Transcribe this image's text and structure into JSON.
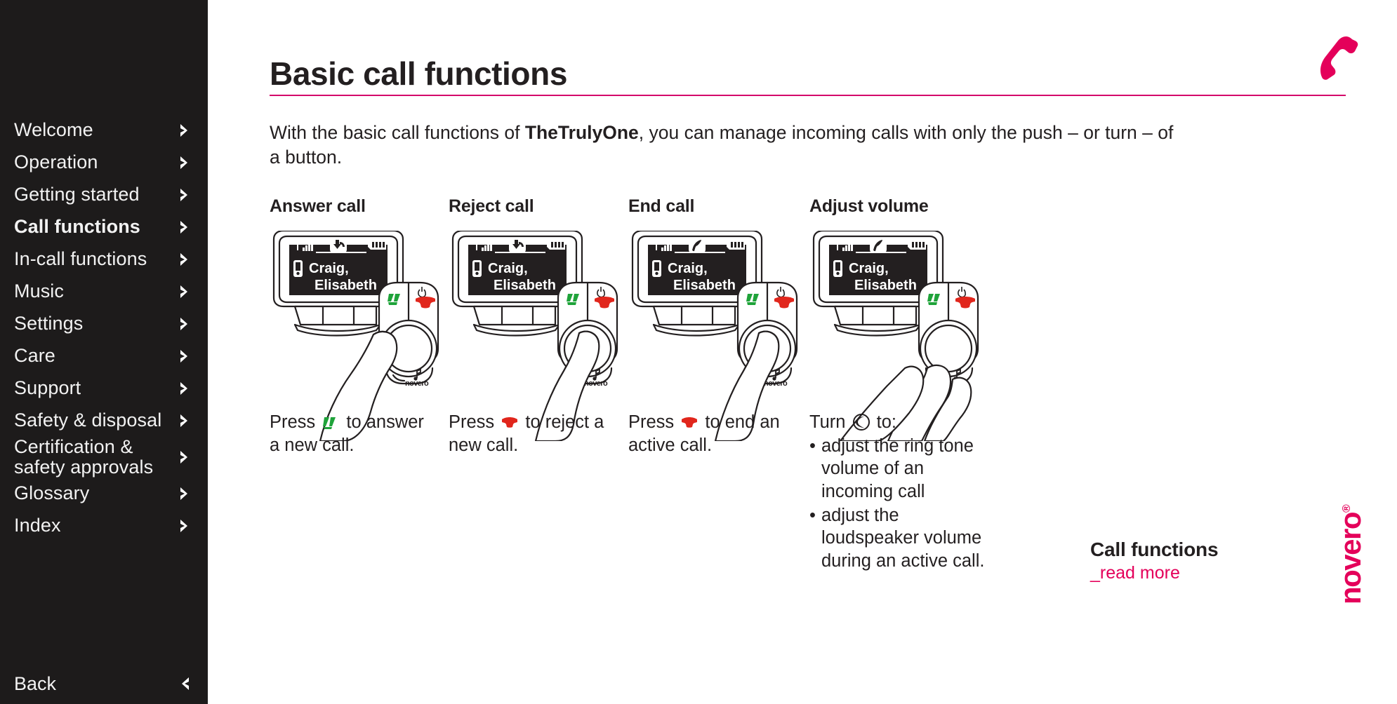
{
  "sidebar": {
    "items": [
      {
        "label": "Welcome",
        "active": false,
        "icon": "chevron-right-icon"
      },
      {
        "label": "Operation",
        "active": false,
        "icon": "chevron-right-icon"
      },
      {
        "label": "Getting started",
        "active": false,
        "icon": "chevron-right-icon"
      },
      {
        "label": "Call functions",
        "active": true,
        "icon": "chevron-right-icon"
      },
      {
        "label": "In-call functions",
        "active": false,
        "icon": "chevron-right-icon"
      },
      {
        "label": "Music",
        "active": false,
        "icon": "chevron-right-icon"
      },
      {
        "label": "Settings",
        "active": false,
        "icon": "chevron-right-icon"
      },
      {
        "label": "Care",
        "active": false,
        "icon": "chevron-right-icon"
      },
      {
        "label": "Support",
        "active": false,
        "icon": "chevron-right-icon"
      },
      {
        "label": "Safety & disposal",
        "active": false,
        "icon": "chevron-right-icon"
      },
      {
        "label": "Certification &\nsafety approvals",
        "active": false,
        "icon": "chevron-right-icon"
      },
      {
        "label": "Glossary",
        "active": false,
        "icon": "chevron-right-icon"
      },
      {
        "label": "Index",
        "active": false,
        "icon": "chevron-right-icon"
      }
    ],
    "back_label": "Back",
    "back_icon": "chevron-left-icon",
    "background_color": "#1d1b1b"
  },
  "header": {
    "title": "Basic call functions",
    "icon": "phone-handset-icon",
    "accent_color": "#d4076a"
  },
  "intro": {
    "before": "With the basic call functions of ",
    "bold": "TheTrulyOne",
    "after": ", you can manage incoming calls with only the push – or turn – of a button."
  },
  "panels": [
    {
      "title": "Answer call",
      "screen": {
        "signal_icon": "signal-bars-icon",
        "status_icon": "incoming-call-icon",
        "battery_icon": "battery-full-icon",
        "contact_icon": "handset-device-icon",
        "contact_line1": "Craig,",
        "contact_line2": "Elisabeth"
      },
      "buttons": {
        "answer_icon": "green-answer-call-icon",
        "answer_color": "#1fa33a",
        "end_icon": "red-end-call-icon",
        "end_color": "#e1261c",
        "power_icon": "power-icon"
      },
      "hand": "one-finger-pressing-answer",
      "dial_brand": "novero"
    },
    {
      "title": "Reject call",
      "screen": {
        "signal_icon": "signal-bars-icon",
        "status_icon": "incoming-call-icon",
        "battery_icon": "battery-full-icon",
        "contact_icon": "handset-device-icon",
        "contact_line1": "Craig,",
        "contact_line2": "Elisabeth"
      },
      "buttons": {
        "answer_icon": "green-answer-call-icon",
        "answer_color": "#1fa33a",
        "end_icon": "red-end-call-icon",
        "end_color": "#e1261c",
        "power_icon": "power-icon"
      },
      "hand": "one-finger-pressing-end",
      "dial_brand": "novero"
    },
    {
      "title": "End call",
      "screen": {
        "signal_icon": "signal-bars-icon",
        "status_icon": "active-call-icon",
        "battery_icon": "battery-full-icon",
        "contact_icon": "handset-device-icon",
        "contact_line1": "Craig,",
        "contact_line2": "Elisabeth"
      },
      "buttons": {
        "answer_icon": "green-answer-call-icon",
        "answer_color": "#1fa33a",
        "end_icon": "red-end-call-icon",
        "end_color": "#e1261c",
        "power_icon": "power-icon"
      },
      "hand": "one-finger-pressing-end",
      "dial_brand": "novero"
    },
    {
      "title": "Adjust volume",
      "screen": {
        "signal_icon": "signal-bars-icon",
        "status_icon": "active-call-icon",
        "battery_icon": "battery-full-icon",
        "contact_icon": "handset-device-icon",
        "contact_line1": "Craig,",
        "contact_line2": "Elisabeth"
      },
      "buttons": {
        "answer_icon": "green-answer-call-icon",
        "answer_color": "#1fa33a",
        "end_icon": "red-end-call-icon",
        "end_color": "#e1261c",
        "power_icon": "power-icon"
      },
      "hand": "two-fingers-turning-dial",
      "dial_brand": "novero"
    }
  ],
  "captions": {
    "answer": {
      "pre": "Press ",
      "icon": "green-answer-call-icon",
      "post": " to answer a new call."
    },
    "reject": {
      "pre": "Press ",
      "icon": "red-end-call-icon",
      "post": " to reject a new call."
    },
    "end": {
      "pre": "Press ",
      "icon": "red-end-call-icon",
      "post": " to end an active call."
    },
    "volume": {
      "pre": "Turn ",
      "icon": "rotary-dial-icon",
      "post": " to:",
      "bullets": [
        "adjust the ring tone volume of an incoming call",
        "adjust the loudspeaker volume during an active call."
      ]
    }
  },
  "read_more": {
    "title": "Call functions",
    "link": "_read more",
    "link_color": "#e4005a"
  },
  "brand": {
    "name": "novero",
    "registered": "®",
    "color": "#e4005a"
  }
}
